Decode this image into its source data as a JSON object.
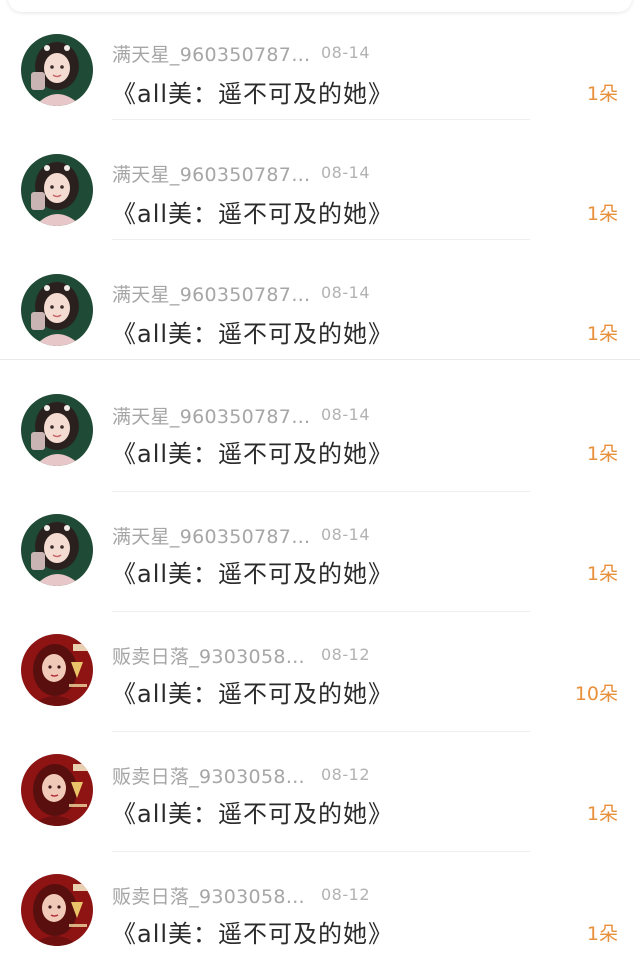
{
  "items": [
    {
      "user": "满天星_960350787…",
      "date": "08-14",
      "title": "《all美：遥不可及的她》",
      "gift": "1朵",
      "avatar": "green"
    },
    {
      "user": "满天星_960350787…",
      "date": "08-14",
      "title": "《all美：遥不可及的她》",
      "gift": "1朵",
      "avatar": "green"
    },
    {
      "user": "满天星_960350787…",
      "date": "08-14",
      "title": "《all美：遥不可及的她》",
      "gift": "1朵",
      "avatar": "green"
    },
    {
      "user": "满天星_960350787…",
      "date": "08-14",
      "title": "《all美：遥不可及的她》",
      "gift": "1朵",
      "avatar": "green"
    },
    {
      "user": "满天星_960350787…",
      "date": "08-14",
      "title": "《all美：遥不可及的她》",
      "gift": "1朵",
      "avatar": "green"
    },
    {
      "user": "贩卖日落_9303058…",
      "date": "08-12",
      "title": "《all美：遥不可及的她》",
      "gift": "10朵",
      "avatar": "red"
    },
    {
      "user": "贩卖日落_9303058…",
      "date": "08-12",
      "title": "《all美：遥不可及的她》",
      "gift": "1朵",
      "avatar": "red"
    },
    {
      "user": "贩卖日落_9303058…",
      "date": "08-12",
      "title": "《all美：遥不可及的她》",
      "gift": "1朵",
      "avatar": "red"
    }
  ],
  "colors": {
    "gift": "#e8903c",
    "username": "#a6a6a6",
    "title": "#2b2b2b",
    "avatar_green_bg": "#1f4a35",
    "avatar_red_bg": "#8e1414"
  }
}
